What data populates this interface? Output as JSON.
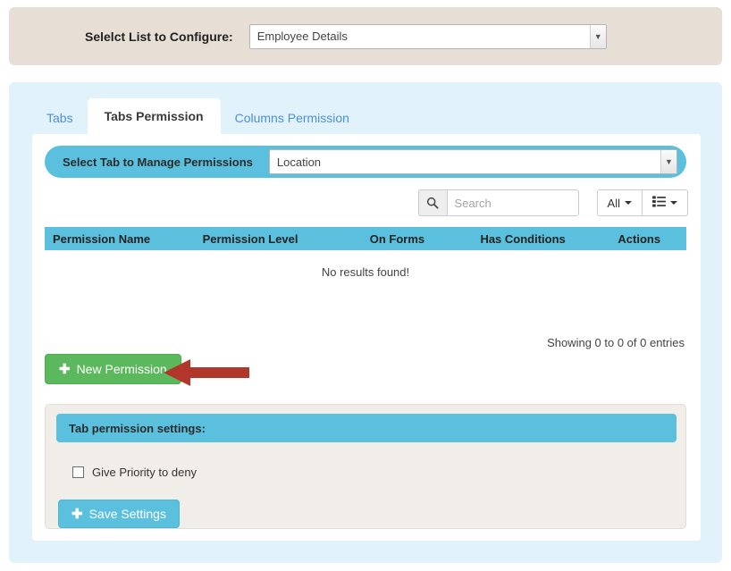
{
  "header": {
    "label": "Selelct List to Configure:",
    "select": {
      "name": "list-to-configure",
      "value": "Employee Details",
      "options": [
        "Employee Details"
      ]
    },
    "panel_color": "#e7ded5"
  },
  "tabs": [
    {
      "label": "Tabs",
      "active": false
    },
    {
      "label": "Tabs Permission",
      "active": true
    },
    {
      "label": "Columns Permission",
      "active": false
    }
  ],
  "select_tab_bar": {
    "label": "Select Tab to Manage Permissions",
    "select": {
      "name": "tab-to-manage",
      "value": "Location",
      "options": [
        "Location"
      ]
    },
    "color": "#5bc0de"
  },
  "filters": {
    "search": {
      "placeholder": "Search",
      "value": "",
      "icon": "search-icon"
    },
    "scope_button": {
      "label": "All",
      "caret": "caret-down-icon"
    },
    "columns_button": {
      "icon": "list-columns-icon",
      "caret": "caret-down-icon"
    }
  },
  "table": {
    "columns": [
      "Permission Name",
      "Permission Level",
      "On Forms",
      "Has Conditions",
      "Actions"
    ],
    "rows": [],
    "empty_message": "No results found!",
    "entries_info": "Showing 0 to 0 of 0 entries",
    "header_color": "#5bc0de"
  },
  "new_permission_button": {
    "label": "New Permission",
    "icon": "plus-icon",
    "color": "#5cb85c"
  },
  "annotation": {
    "type": "arrow-left",
    "color": "#b0372a"
  },
  "settings": {
    "title": "Tab permission settings:",
    "checkbox": {
      "label": "Give Priority to deny",
      "checked": false
    },
    "save_button": {
      "label": "Save Settings",
      "icon": "plus-icon",
      "color": "#5bc0de"
    },
    "panel_color": "#f1ede8"
  },
  "theme": {
    "main_panel_color": "#e2f2fb",
    "card_color": "#ffffff",
    "link_color": "#4a90d9"
  }
}
